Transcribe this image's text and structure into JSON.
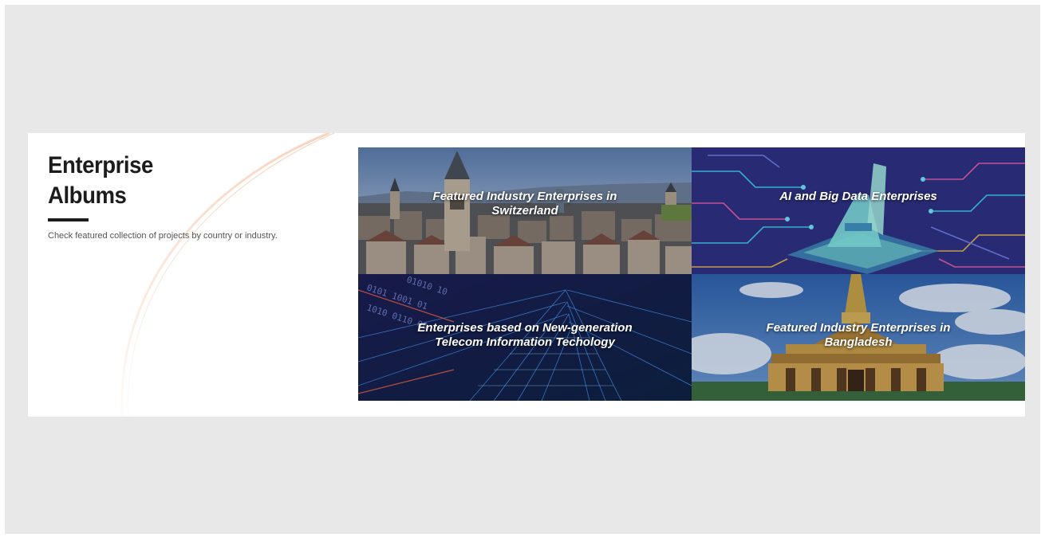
{
  "section": {
    "title_line1": "Enterprise",
    "title_line2": "Albums",
    "subtitle": "Check featured collection of projects by country or industry."
  },
  "albums": [
    {
      "label": "Featured Industry Enterprises in Switzerland",
      "image": "zurich-cityscape"
    },
    {
      "label": "AI and Big Data Enterprises",
      "image": "ai-circuit-board"
    },
    {
      "label": "Enterprises based on New-generation Telecom Information Techology",
      "image": "digital-skyscraper"
    },
    {
      "label": "Featured Industry Enterprises in Bangladesh",
      "image": "golden-pagoda"
    }
  ],
  "colors": {
    "frame": "#e8e8e8",
    "panel": "#ffffff",
    "heading": "#1c1c1c",
    "subtitle": "#555555",
    "accent_arc": "#f4b08a"
  }
}
